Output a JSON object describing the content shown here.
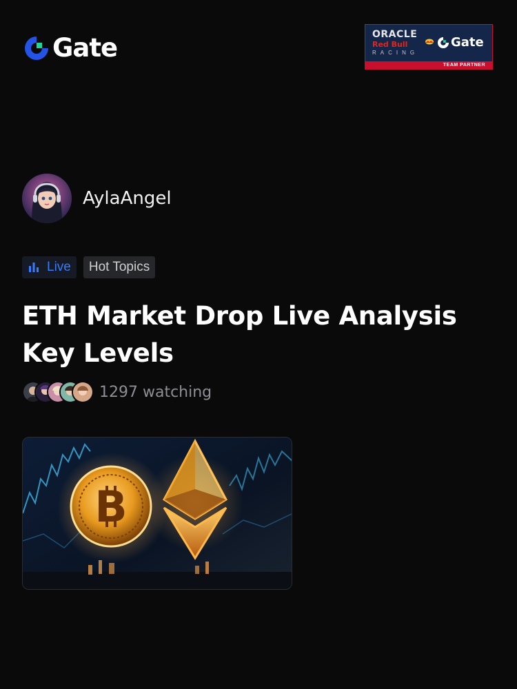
{
  "brand": {
    "name": "Gate",
    "accent": "#2354e6",
    "accent_light": "#1fd69a"
  },
  "partner": {
    "oracle": "ORACLE",
    "redbull": "Red Bull",
    "racing": "RACING",
    "gate": "Gate",
    "label": "TEAM PARTNER"
  },
  "author": {
    "name": "AylaAngel",
    "avatar": "avatar-icon"
  },
  "tags": {
    "live": "Live",
    "hot": "Hot Topics"
  },
  "post": {
    "title": "ETH Market Drop Live Analysis Key Levels",
    "watching": "1297 watching"
  },
  "colors": {
    "background": "#0a0a0b",
    "live": "#3a7bfd",
    "muted": "#8e8e94"
  }
}
